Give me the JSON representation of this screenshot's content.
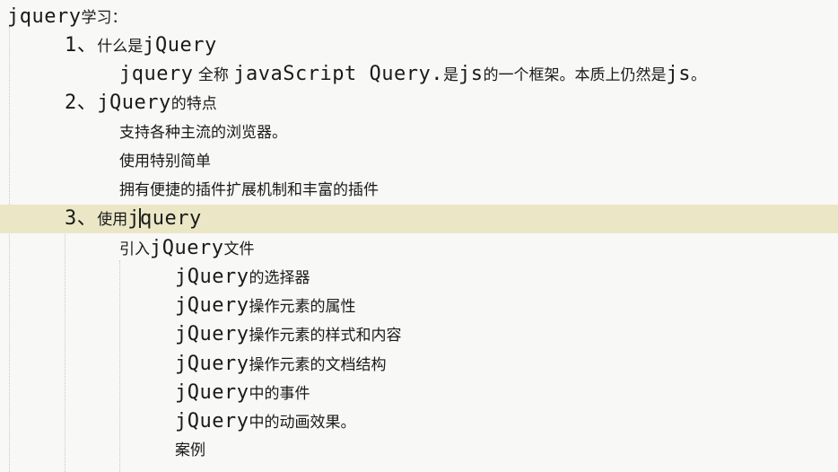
{
  "doc": {
    "title": {
      "mono": "jquery",
      "cjk": "学习："
    },
    "s1": {
      "num": "1、",
      "cjk": "什么是",
      "mono": "jQuery"
    },
    "s1_desc": {
      "mono1": "jquery",
      "cjk1": " 全称 ",
      "mono2": "javaScript Query.",
      "cjk2": "是",
      "mono3": "js",
      "cjk3": "的一个框架。本质上仍然是",
      "mono4": "js",
      "cjk4": "。"
    },
    "s2": {
      "num": "2、",
      "mono": "jQuery",
      "cjk": "的特点"
    },
    "s2_items": [
      "支持各种主流的浏览器。",
      "使用特别简单",
      "拥有便捷的插件扩展机制和丰富的插件"
    ],
    "s3": {
      "num": "3、",
      "cjk": "使用",
      "mono_a": "j",
      "mono_b": "query"
    },
    "s3_intro": {
      "cjk1": "引入",
      "mono": "jQuery",
      "cjk2": "文件"
    },
    "s3_items": [
      {
        "mono": "jQuery",
        "cjk": "的选择器"
      },
      {
        "mono": "jQuery",
        "cjk": "操作元素的属性"
      },
      {
        "mono": "jQuery",
        "cjk": "操作元素的样式和内容"
      },
      {
        "mono": "jQuery",
        "cjk": "操作元素的文档结构"
      },
      {
        "mono": "jQuery",
        "cjk": "中的事件"
      },
      {
        "mono": "jQuery",
        "cjk": "中的动画效果。"
      }
    ],
    "s3_case": "案例"
  },
  "colors": {
    "background": "#f8f8f6",
    "current_line": "#ebe7c6",
    "text": "#1a1a1a",
    "indent_guide": "#c9c9c9"
  }
}
